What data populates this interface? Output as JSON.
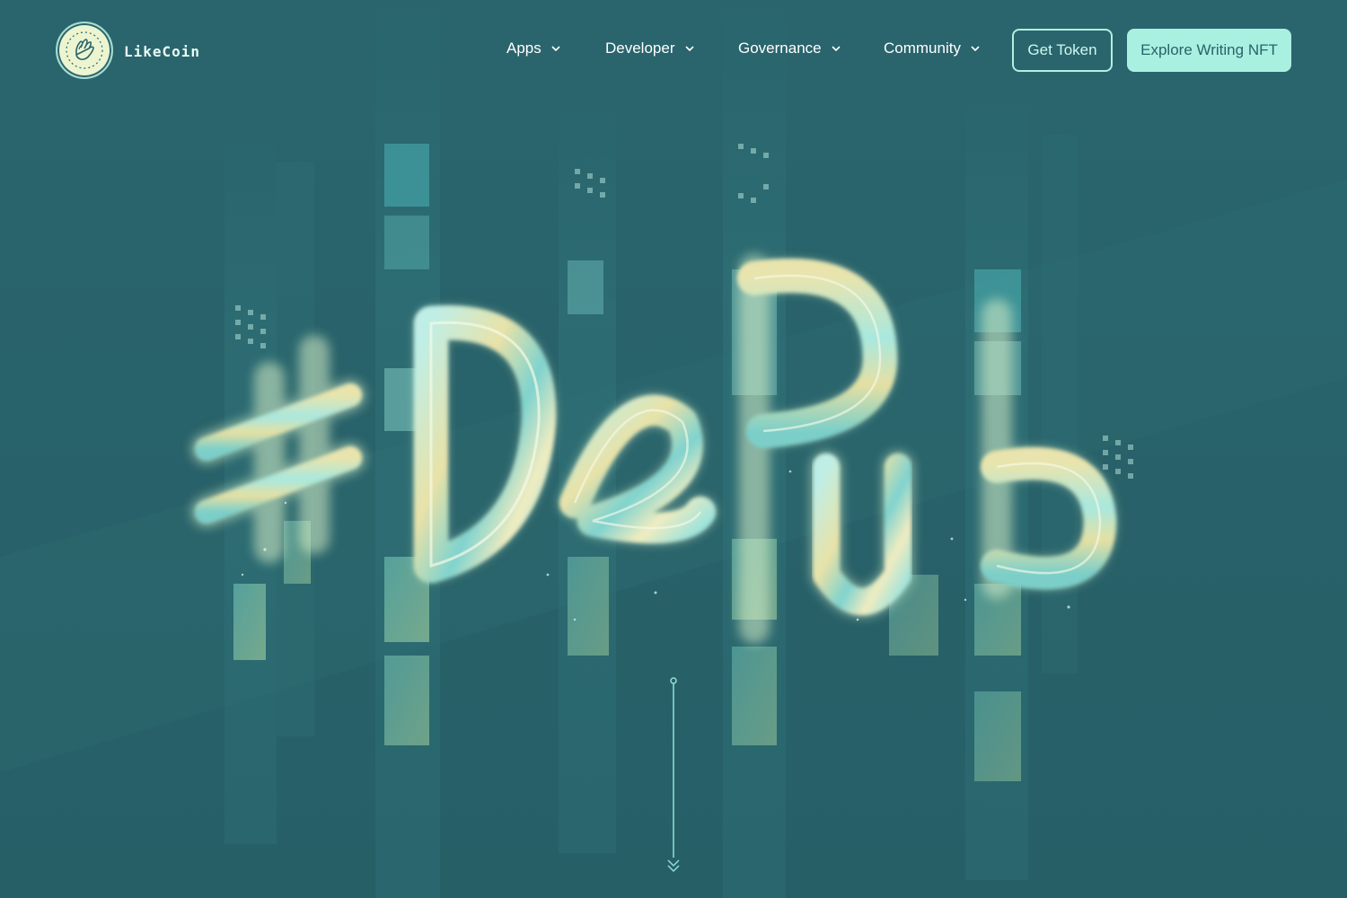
{
  "brand": {
    "name": "LikeCoin",
    "logo_icon": "clapping-hand-icon"
  },
  "nav": {
    "items": [
      {
        "label": "Apps",
        "icon": "chevron-down-icon"
      },
      {
        "label": "Developer",
        "icon": "chevron-down-icon"
      },
      {
        "label": "Governance",
        "icon": "chevron-down-icon"
      },
      {
        "label": "Community",
        "icon": "chevron-down-icon"
      }
    ]
  },
  "actions": {
    "get_token_label": "Get Token",
    "explore_label": "Explore Writing NFT"
  },
  "hero": {
    "artwork_text": "#DePub",
    "scroll_icon": "scroll-down-arrow-icon"
  },
  "colors": {
    "background": "#28636b",
    "accent": "#aaf0e1",
    "accent_outline": "#aff0e3",
    "art_yellow": "#e7e0a4",
    "art_cyan": "#9ee6df"
  }
}
